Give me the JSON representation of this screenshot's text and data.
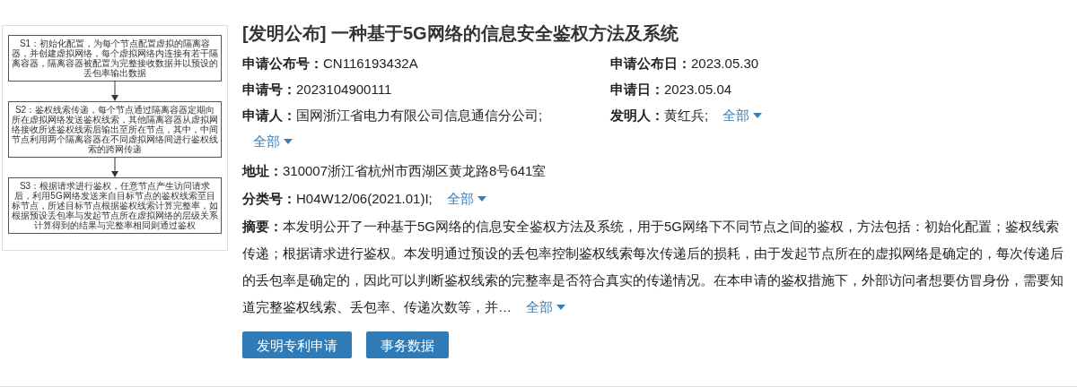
{
  "flowchart": {
    "steps": [
      {
        "text": "S1：初始化配置，为每个节点配置虚拟的隔离容器，并创建虚拟网络，每个虚拟网络内连接有若干隔离容器，隔离容器被配置为完整接收数据并以预设的丢包率输出数据"
      },
      {
        "text": "S2：鉴权线索传递，每个节点通过隔离容器定期向所在虚拟网络发送鉴权线索，其他隔离容器从虚拟网络接收所述鉴权线索后输出至所在节点，其中，中间节点利用两个隔离容器在不同虚拟网络间进行鉴权线索的跨网传递"
      },
      {
        "text": "S3：根据请求进行鉴权，任意节点产生访问请求后，利用5G网络发送来自目标节点的鉴权线索至目标节点，所述目标节点根据鉴权线索计算完整率，如根据预设丢包率与发起节点所在虚拟网络的层级关系计算得到的结果与完整率相同则通过鉴权"
      }
    ]
  },
  "title": "[发明公布] 一种基于5G网络的信息安全鉴权方法及系统",
  "pub_no": {
    "label": "申请公布号：",
    "value": "CN116193432A"
  },
  "pub_date": {
    "label": "申请公布日：",
    "value": "2023.05.30"
  },
  "app_no": {
    "label": "申请号：",
    "value": "2023104900111"
  },
  "app_date": {
    "label": "申请日：",
    "value": "2023.05.04"
  },
  "applicant": {
    "label": "申请人：",
    "value": "国网浙江省电力有限公司信息通信分公司;",
    "more": "全部"
  },
  "inventor": {
    "label": "发明人：",
    "value": "黄红兵;",
    "more": "全部"
  },
  "address": {
    "label": "地址：",
    "value": "310007浙江省杭州市西湖区黄龙路8号641室"
  },
  "classification": {
    "label": "分类号：",
    "value": "H04W12/06(2021.01)I;",
    "more": "全部"
  },
  "abstract": {
    "label": "摘要：",
    "value": "本发明公开了一种基于5G网络的信息安全鉴权方法及系统，用于5G网络下不同节点之间的鉴权，方法包括：初始化配置；鉴权线索传递；根据请求进行鉴权。本发明通过预设的丢包率控制鉴权线索每次传递后的损耗，由于发起节点所在的虚拟网络是确定的，每次传递后的丢包率是确定的，因此可以判断鉴权线索的完整率是否符合真实的传递情况。在本申请的鉴权措施下，外部访问者想要仿冒身份，需要知道完整鉴权线索、丢包率、传递次数等，并…",
    "more": "全部"
  },
  "buttons": [
    "发明专利申请",
    "事务数据"
  ]
}
